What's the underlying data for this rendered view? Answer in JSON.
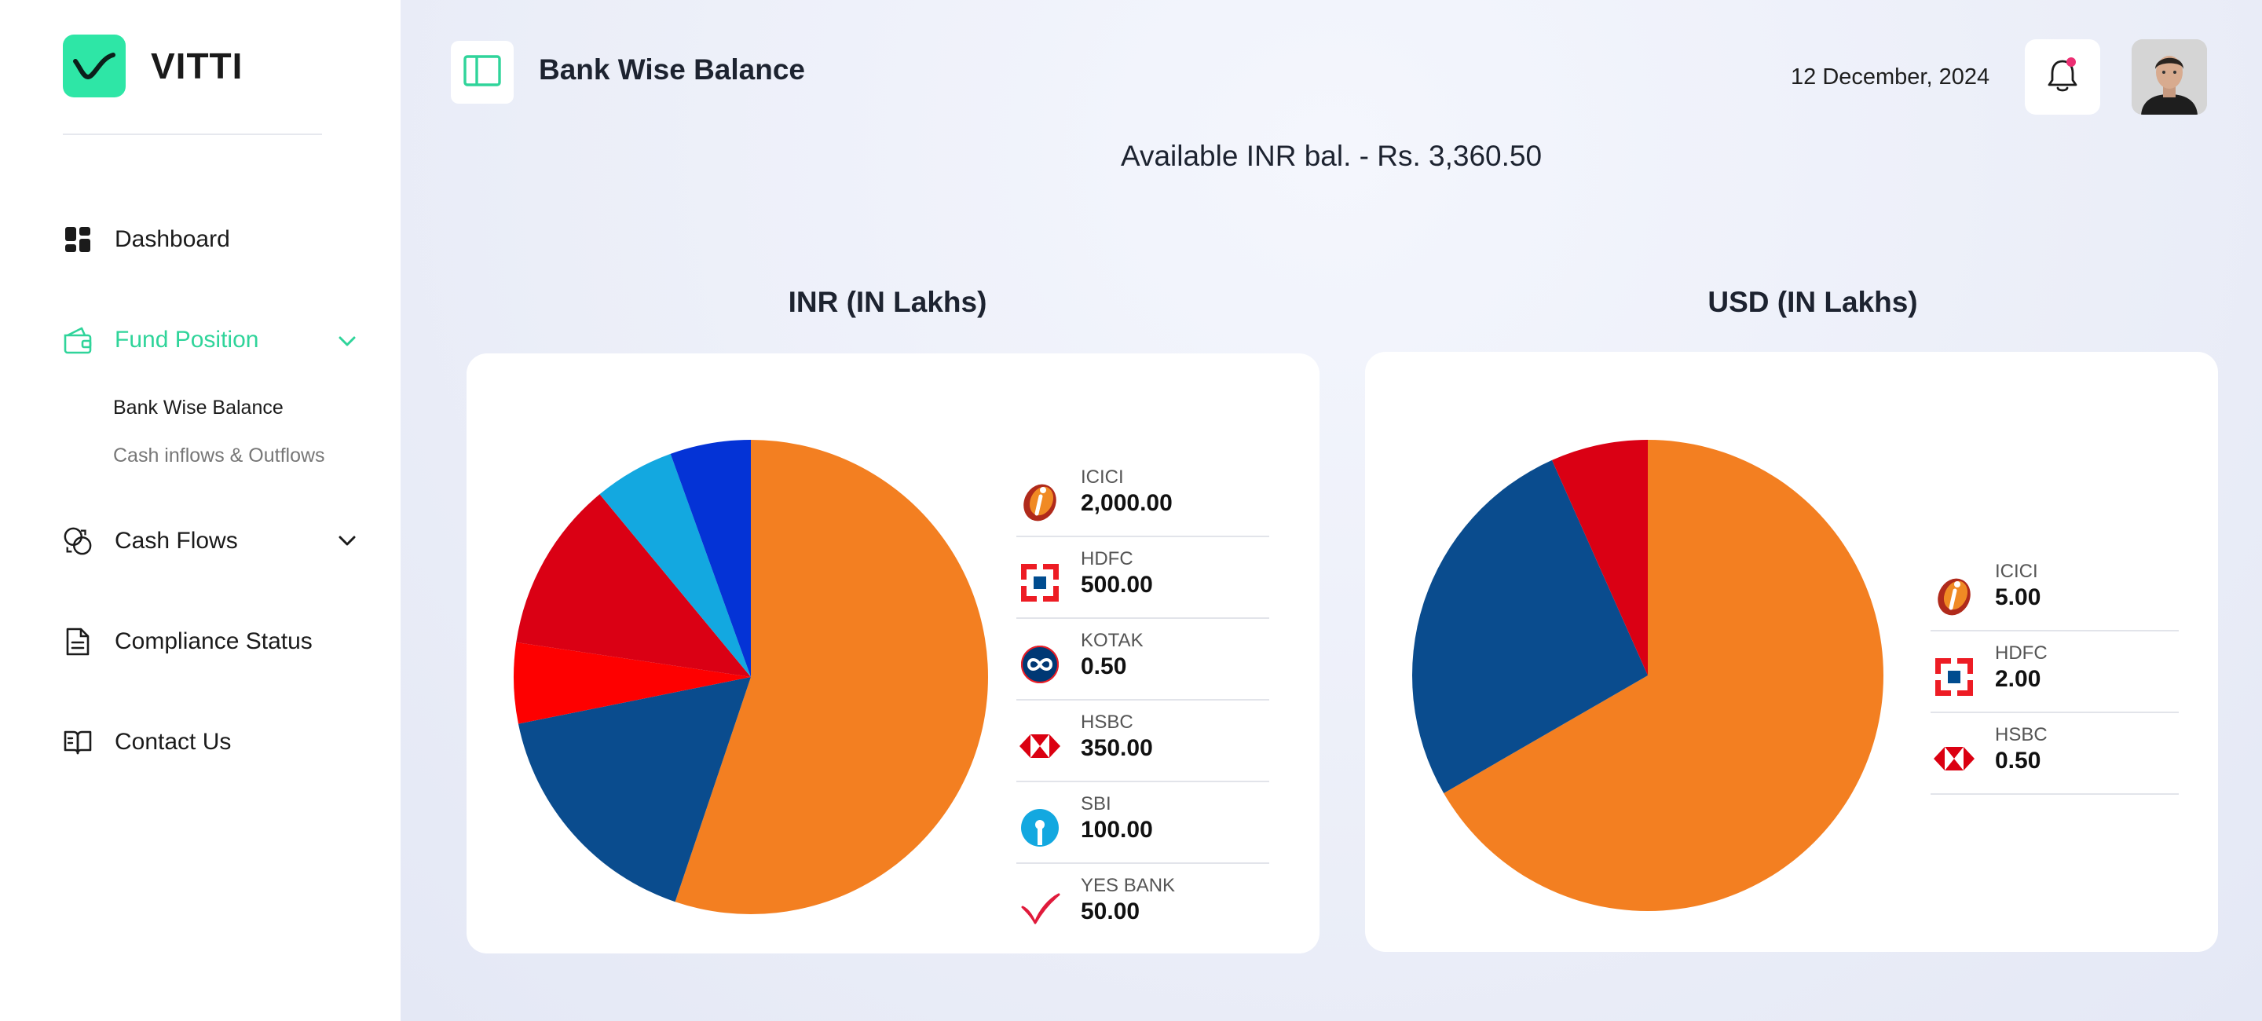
{
  "brand": {
    "name": "VITTI"
  },
  "nav": {
    "dashboard": "Dashboard",
    "fund_position": "Fund Position",
    "fund_sub": [
      "Bank Wise Balance",
      "Cash inflows & Outflows"
    ],
    "cash_flows": "Cash Flows",
    "compliance": "Compliance Status",
    "contact": "Contact Us"
  },
  "header": {
    "title": "Bank Wise Balance",
    "date": "12 December, 2024",
    "available": "Available INR bal. - Rs. 3,360.50"
  },
  "colors": {
    "accent": "#2fd49a",
    "orange": "#f37f21",
    "navy": "#0a4c8e",
    "red": "#da0014",
    "bright_red": "#fe0000",
    "sky": "#13a8e0",
    "blue": "#0433d6"
  },
  "chart_data": [
    {
      "type": "pie",
      "title": "INR (IN Lakhs)",
      "slices": [
        {
          "name": "ICICI",
          "value": 2000.0,
          "label": "2,000.00",
          "color": "#f37f21",
          "icon": "icici-logo-icon"
        },
        {
          "name": "HDFC",
          "value": 500.0,
          "label": "500.00",
          "color": "#0a4c8e",
          "icon": "hdfc-logo-icon"
        },
        {
          "name": "KOTAK",
          "value": 0.5,
          "label": "0.50",
          "color": "#fe0000",
          "icon": "kotak-logo-icon"
        },
        {
          "name": "HSBC",
          "value": 350.0,
          "label": "350.00",
          "color": "#da0014",
          "icon": "hsbc-logo-icon"
        },
        {
          "name": "SBI",
          "value": 100.0,
          "label": "100.00",
          "color": "#13a8e0",
          "icon": "sbi-logo-icon"
        },
        {
          "name": "YES BANK",
          "value": 50.0,
          "label": "50.00",
          "color": "#0433d6",
          "icon": "yesbank-logo-icon"
        }
      ]
    },
    {
      "type": "pie",
      "title": "USD (IN Lakhs)",
      "slices": [
        {
          "name": "ICICI",
          "value": 5.0,
          "label": "5.00",
          "color": "#f37f21",
          "icon": "icici-logo-icon"
        },
        {
          "name": "HDFC",
          "value": 2.0,
          "label": "2.00",
          "color": "#0a4c8e",
          "icon": "hdfc-logo-icon"
        },
        {
          "name": "HSBC",
          "value": 0.5,
          "label": "0.50",
          "color": "#da0014",
          "icon": "hsbc-logo-icon"
        }
      ]
    }
  ]
}
